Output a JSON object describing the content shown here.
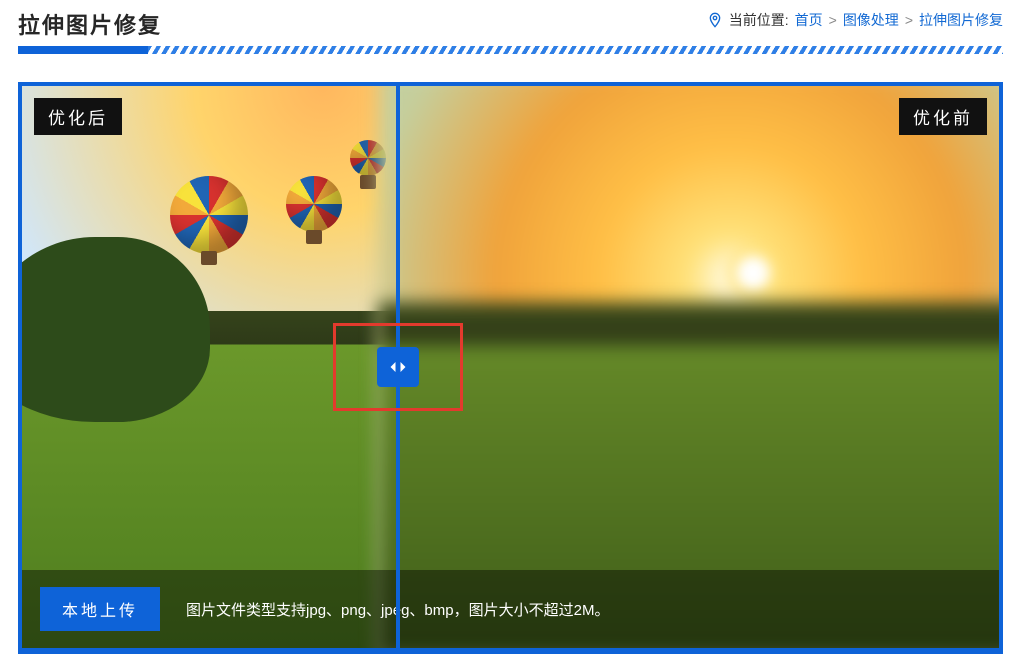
{
  "header": {
    "title": "拉伸图片修复",
    "location_label": "当前位置:",
    "crumbs": [
      "首页",
      "图像处理",
      "拉伸图片修复"
    ]
  },
  "compare": {
    "after_label": "优化后",
    "before_label": "优化前"
  },
  "footer": {
    "upload_label": "本地上传",
    "hint": "图片文件类型支持jpg、png、jpeg、bmp，图片大小不超过2M。"
  }
}
